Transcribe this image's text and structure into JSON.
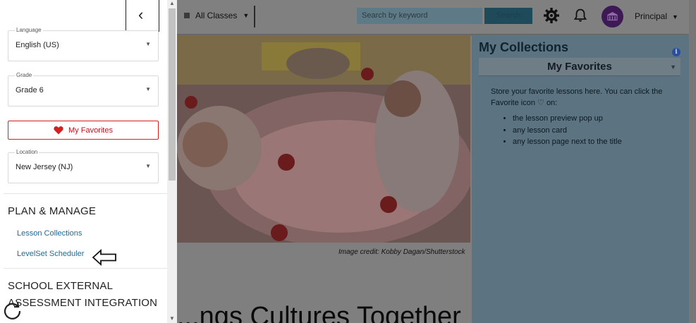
{
  "header": {
    "class_selector": "All Classes",
    "search_placeholder": "Search by keyword",
    "search_button": "Search",
    "role": "Principal"
  },
  "main": {
    "image_credit": "Image credit: Kobby Dagan/Shutterstock",
    "lesson_title": "...ngs Cultures Together"
  },
  "collections": {
    "title": "My Collections",
    "selected": "My Favorites",
    "description": "Store your favorite lessons here. You can click the Favorite icon ♡ on:",
    "items": [
      "the lesson preview pop up",
      "any lesson card",
      "any lesson page next to the title"
    ]
  },
  "sidebar": {
    "language": {
      "label": "Language",
      "value": "English (US)"
    },
    "grade": {
      "label": "Grade",
      "value": "Grade 6"
    },
    "favorites_button": "My Favorites",
    "location": {
      "label": "Location",
      "value": "New Jersey (NJ)"
    },
    "plan_manage": {
      "heading": "PLAN & MANAGE",
      "links": [
        "Lesson Collections",
        "LevelSet Scheduler"
      ]
    },
    "assessment": {
      "heading_line1": "SCHOOL EXTERNAL",
      "heading_line2": "ASSESSMENT INTEGRATION"
    }
  },
  "colors": {
    "accent_red": "#d32121",
    "link_blue": "#1f6b97",
    "avatar_purple": "#5b2a7c"
  },
  "icons": [
    "chevron-left-icon",
    "caret-down-icon",
    "gear-icon",
    "bell-icon",
    "school-icon",
    "info-icon",
    "heart-icon",
    "arrow-left-icon",
    "refresh-icon"
  ]
}
